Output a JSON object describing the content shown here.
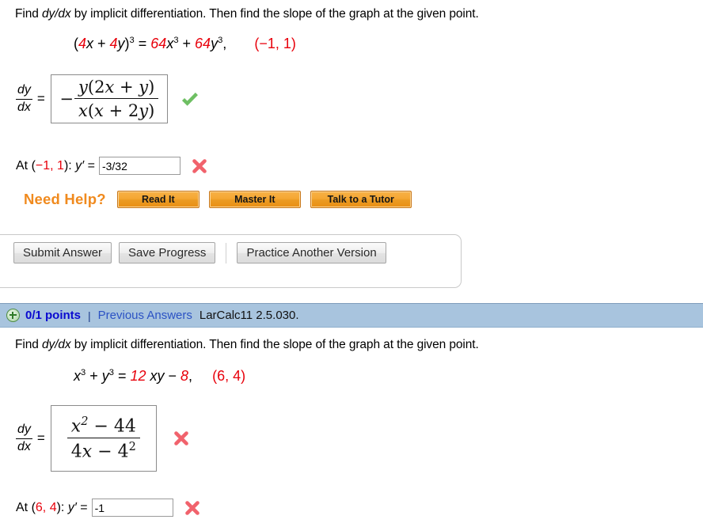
{
  "problem1": {
    "prompt_a": "Find ",
    "prompt_dydx": "dy/dx",
    "prompt_b": " by implicit differentiation. Then find the slope of the graph at the given point.",
    "equation": {
      "lhs_open": "(",
      "lhs_4a": "4",
      "lhs_x": "x",
      "lhs_plus": " + ",
      "lhs_4b": "4",
      "lhs_y": "y",
      "lhs_close": ")",
      "lhs_exp": "3",
      "equals": " = ",
      "rhs_64a": "64",
      "rhs_x": "x",
      "rhs_xexp": "3",
      "rhs_plus": " + ",
      "rhs_64b": "64",
      "rhs_y": "y",
      "rhs_yexp": "3",
      "comma": ",",
      "point": "(−1, 1)"
    },
    "dydx_label_top": "dy",
    "dydx_label_bottom": "dx",
    "equals_sign": "=",
    "answer": {
      "sign": "−",
      "numerator_y": "y",
      "numerator_open": "(",
      "numerator_2": "2",
      "numerator_x": "x",
      "numerator_plus": " + ",
      "numerator_y2": "y",
      "numerator_close": ")",
      "denominator_x": "x",
      "denominator_open": "(",
      "denominator_x2": "x",
      "denominator_plus": " + ",
      "denominator_2": "2",
      "denominator_y": "y",
      "denominator_close": ")"
    },
    "answer_status": "correct",
    "at_prefix": "At (",
    "at_point_a": "−1",
    "at_point_sep": ", ",
    "at_point_b": "1",
    "at_suffix": "): ",
    "at_yprime": "y′",
    "at_equals": " = ",
    "at_value": "-3/32",
    "at_placeholder": "",
    "at_status": "incorrect",
    "need_help_label": "Need Help?",
    "help_buttons": [
      {
        "label": "Read It",
        "width_class": "w1"
      },
      {
        "label": "Master It",
        "width_class": "w2"
      },
      {
        "label": "Talk to a Tutor",
        "width_class": "w3"
      }
    ],
    "submit_buttons": [
      {
        "label": "Submit Answer"
      },
      {
        "label": "Save Progress"
      }
    ],
    "practice_button": "Practice Another Version"
  },
  "header2": {
    "plus_icon": "plus-circle-icon",
    "points": "0/1 points",
    "pipe": "|",
    "previous_answers": "Previous Answers",
    "question_id": "LarCalc11 2.5.030."
  },
  "problem2": {
    "prompt_a": "Find ",
    "prompt_dydx": "dy/dx",
    "prompt_b": " by implicit differentiation. Then find the slope of the graph at the given point.",
    "equation": {
      "lhs_x": "x",
      "lhs_xexp": "3",
      "lhs_plus": " + ",
      "lhs_y": "y",
      "lhs_yexp": "3",
      "equals": " = ",
      "rhs_12": "12",
      "rhs_xy": " xy",
      "rhs_minus": " − ",
      "rhs_8": "8",
      "comma": ",",
      "point": "(6, 4)"
    },
    "dydx_label_top": "dy",
    "dydx_label_bottom": "dx",
    "equals_sign": "=",
    "answer": {
      "numerator_x": "x",
      "numerator_xexp": "2",
      "numerator_minus": " − ",
      "numerator_44": "44",
      "denominator_4x": "4",
      "denominator_x": "x",
      "denominator_minus": " − ",
      "denominator_4": "4",
      "denominator_exp": "2"
    },
    "answer_status": "incorrect",
    "at_prefix": "At (",
    "at_point_a": "6",
    "at_point_sep": ", ",
    "at_point_b": "4",
    "at_suffix": "): ",
    "at_yprime": "y′",
    "at_equals": " = ",
    "at_value": "-1",
    "at_placeholder": "",
    "at_status": "incorrect"
  },
  "colors": {
    "red_number": "#e8000b",
    "orange_label": "#f08a1e",
    "blue_bar": "#a8c4de",
    "points_blue": "#0a0ad0",
    "link_blue": "#2b52c4",
    "check_green": "#6ebf63",
    "x_red": "#f1626c"
  }
}
